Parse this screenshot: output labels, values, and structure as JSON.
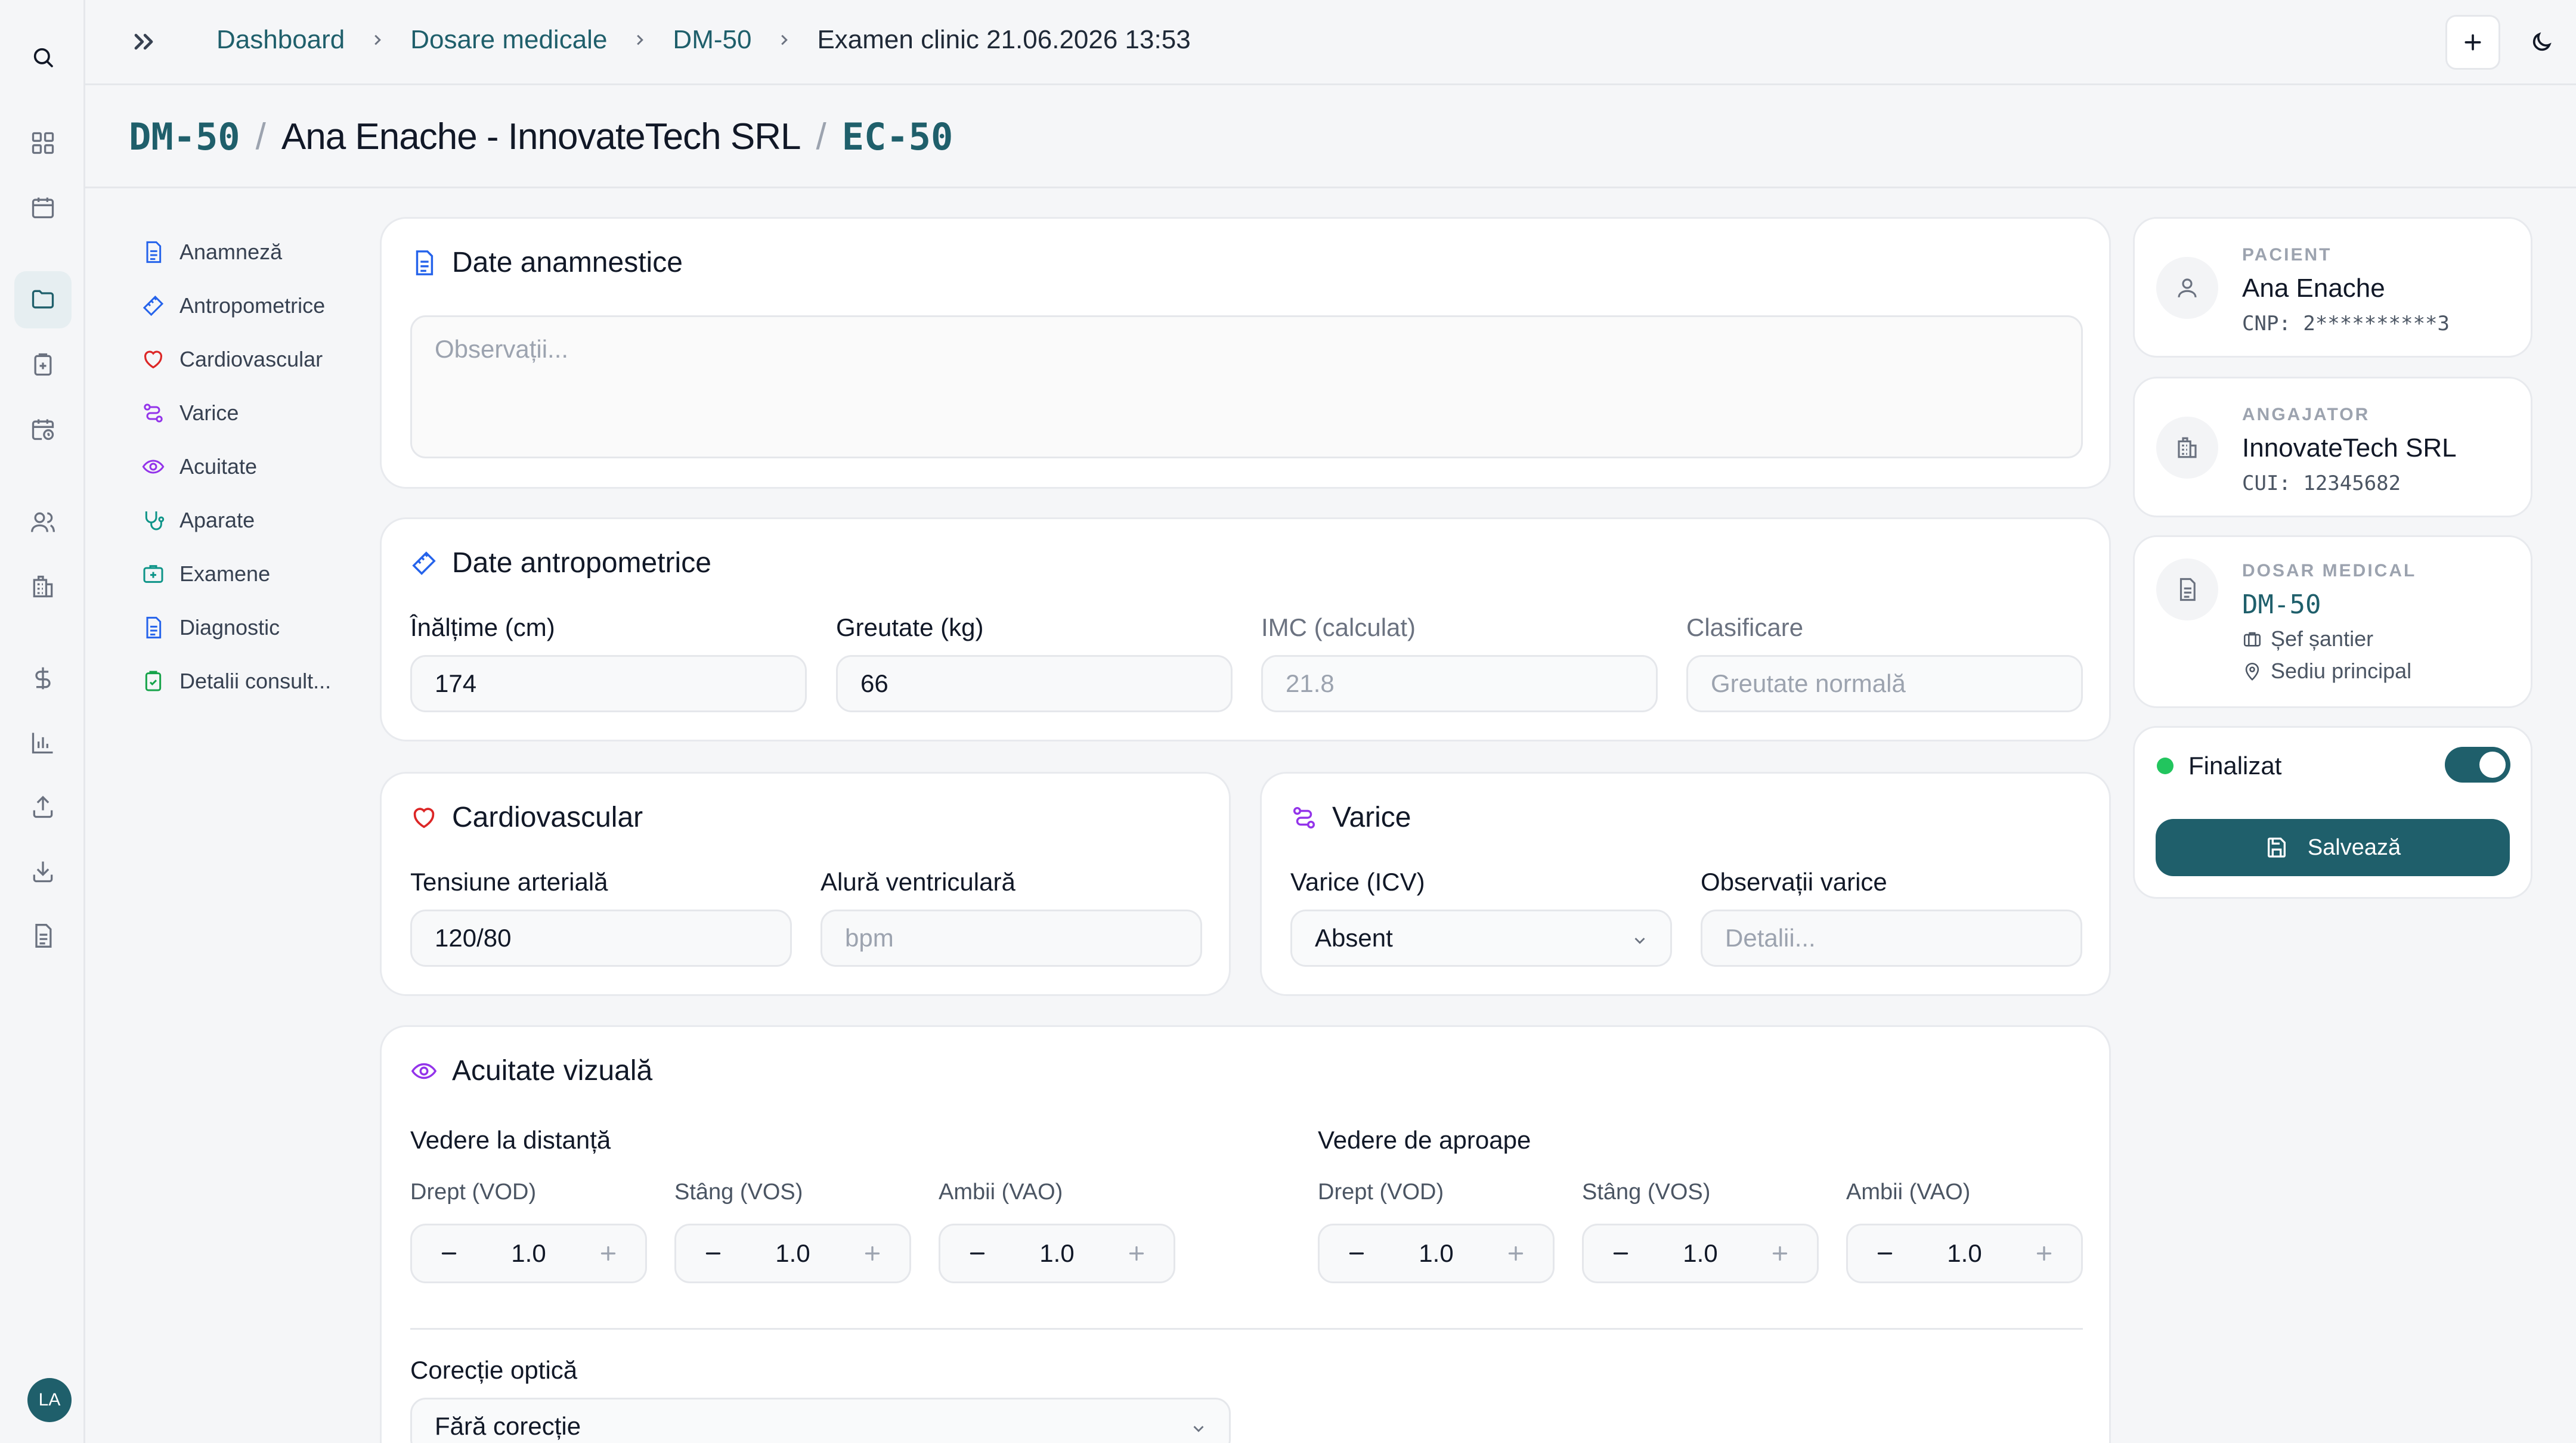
{
  "breadcrumb": {
    "items": [
      "Dashboard",
      "Dosare medicale",
      "DM-50"
    ],
    "current": "Examen clinic 21.06.2026 13:53"
  },
  "title": {
    "record_code": "DM-50",
    "separator": "/",
    "patient_company": "Ana Enache - InnovateTech SRL",
    "exam_code": "EC-50"
  },
  "sections_nav": [
    "Anamneză",
    "Antropometrice",
    "Cardiovascular",
    "Varice",
    "Acuitate",
    "Aparate",
    "Examene",
    "Diagnostic",
    "Detalii consult..."
  ],
  "anamnesis": {
    "title": "Date anamnestice",
    "placeholder": "Observații..."
  },
  "anthropometric": {
    "title": "Date antropometrice",
    "height_label": "Înălțime (cm)",
    "height_value": "174",
    "weight_label": "Greutate (kg)",
    "weight_value": "66",
    "bmi_label": "IMC (calculat)",
    "bmi_value": "21.8",
    "class_label": "Clasificare",
    "class_value": "Greutate normală"
  },
  "cardio": {
    "title": "Cardiovascular",
    "bp_label": "Tensiune arterială",
    "bp_value": "120/80",
    "hr_label": "Alură ventriculară",
    "hr_placeholder": "bpm"
  },
  "varicose": {
    "title": "Varice",
    "icv_label": "Varice (ICV)",
    "icv_value": "Absent",
    "notes_label": "Observații varice",
    "notes_placeholder": "Detalii..."
  },
  "visual": {
    "title": "Acuitate vizuală",
    "distance_title": "Vedere la distanță",
    "near_title": "Vedere de aproape",
    "distance": [
      {
        "label": "Drept (VOD)",
        "value": "1.0"
      },
      {
        "label": "Stâng (VOS)",
        "value": "1.0"
      },
      {
        "label": "Ambii (VAO)",
        "value": "1.0"
      }
    ],
    "near": [
      {
        "label": "Drept (VOD)",
        "value": "1.0"
      },
      {
        "label": "Stâng (VOS)",
        "value": "1.0"
      },
      {
        "label": "Ambii (VAO)",
        "value": "1.0"
      }
    ],
    "correction_label": "Corecție optică",
    "correction_value": "Fără corecție"
  },
  "patient": {
    "caption": "PACIENT",
    "name": "Ana Enache",
    "cnp": "CNP: 2**********3"
  },
  "employer": {
    "caption": "ANGAJATOR",
    "name": "InnovateTech SRL",
    "cui": "CUI: 12345682"
  },
  "record": {
    "caption": "DOSAR MEDICAL",
    "code": "DM-50",
    "job": "Șef șantier",
    "location": "Sediu principal"
  },
  "status": {
    "label": "Finalizat",
    "finalized": true,
    "dot_color": "#22c55e"
  },
  "save_label": "Salvează",
  "user_initials": "LA",
  "colors": {
    "accent": "#1f5f6b",
    "danger": "#dc2626",
    "purple": "#9333ea",
    "blue": "#2563eb",
    "teal": "#0d9488",
    "green": "#16a34a"
  }
}
